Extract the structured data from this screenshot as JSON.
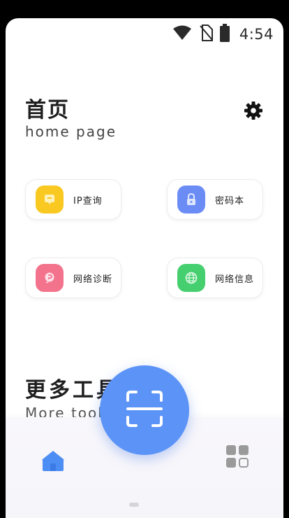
{
  "status_bar": {
    "time": "4:54",
    "icons": [
      "wifi-icon",
      "no-sim-icon",
      "battery-icon"
    ]
  },
  "header": {
    "title": "首页",
    "subtitle": "home page",
    "settings_icon": "gear-icon"
  },
  "tools": [
    {
      "label": "IP查询",
      "icon": "ip-icon",
      "color": "#f9c821"
    },
    {
      "label": "密码本",
      "icon": "lock-icon",
      "color": "#6c8cf5"
    },
    {
      "label": "网络诊断",
      "icon": "diagnose-icon",
      "color": "#f3738d"
    },
    {
      "label": "网络信息",
      "icon": "globe-icon",
      "color": "#45cf6f"
    }
  ],
  "more": {
    "title": "更多工具",
    "subtitle": "More tools"
  },
  "bottom_nav": {
    "home_icon": "home-icon",
    "scan_icon": "scan-icon",
    "grid_icon": "grid-icon"
  },
  "colors": {
    "accent": "#5b93f7",
    "nav_home": "#4d8ef5",
    "nav_grid": "#9a9a9a"
  }
}
